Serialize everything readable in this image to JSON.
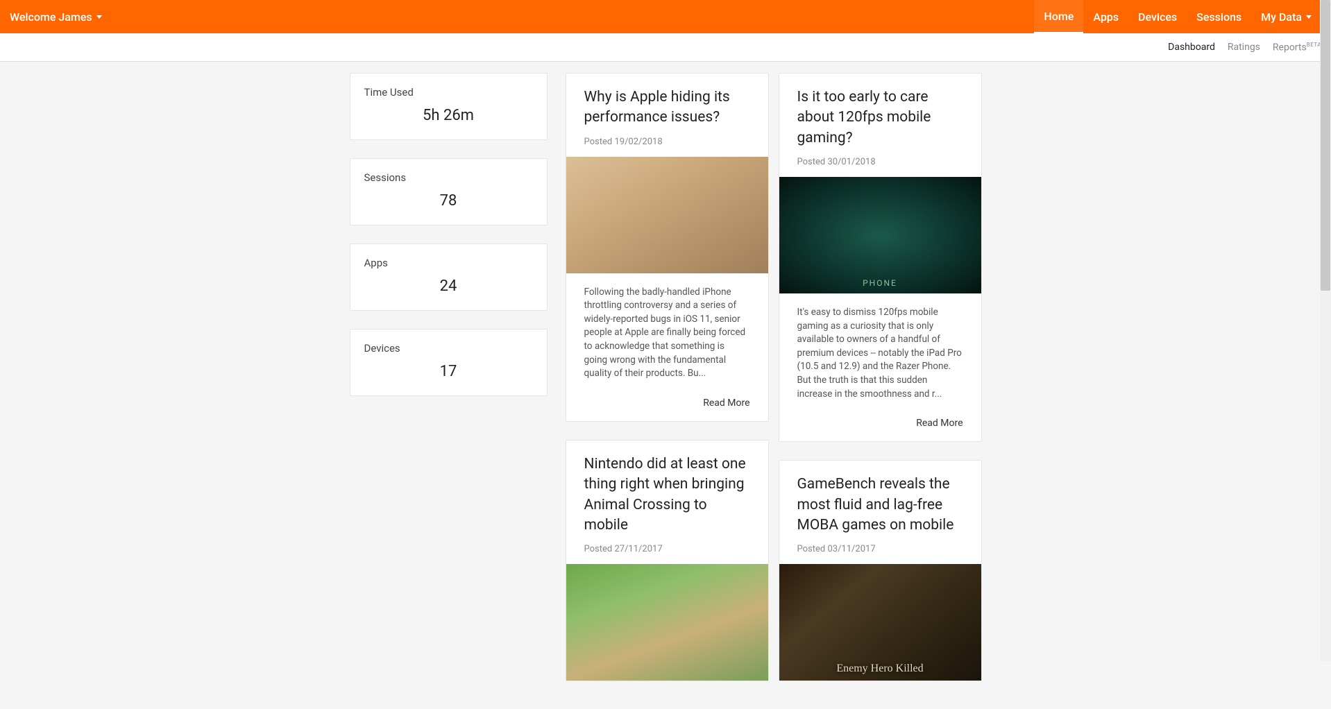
{
  "header": {
    "welcome": "Welcome James",
    "nav": [
      {
        "label": "Home",
        "active": true,
        "caret": false
      },
      {
        "label": "Apps",
        "active": false,
        "caret": false
      },
      {
        "label": "Devices",
        "active": false,
        "caret": false
      },
      {
        "label": "Sessions",
        "active": false,
        "caret": false
      },
      {
        "label": "My Data",
        "active": false,
        "caret": true
      }
    ]
  },
  "subnav": {
    "items": [
      {
        "label": "Dashboard",
        "active": true
      },
      {
        "label": "Ratings",
        "active": false
      },
      {
        "label": "Reports",
        "active": false,
        "beta": "BETA"
      }
    ]
  },
  "stats": [
    {
      "label": "Time Used",
      "value": "5h 26m"
    },
    {
      "label": "Sessions",
      "value": "78"
    },
    {
      "label": "Apps",
      "value": "24"
    },
    {
      "label": "Devices",
      "value": "17"
    }
  ],
  "articles": {
    "posted_prefix": "Posted ",
    "read_more": "Read More",
    "img_overlays": {
      "razer_phone": "PHONE",
      "enemy_killed": "Enemy Hero Killed"
    },
    "left": [
      {
        "title": "Why is Apple hiding its performance issues?",
        "date": "19/02/2018",
        "excerpt": "Following the badly-handled iPhone throttling controversy and a series of widely-reported bugs in iOS 11, senior people at Apple are finally being forced to acknowledge that something is going wrong with the fundamental quality of their products. Bu...",
        "imgclass": "img1"
      },
      {
        "title": "Nintendo did at least one thing right when bringing Animal Crossing to mobile",
        "date": "27/11/2017",
        "excerpt": "",
        "imgclass": "img3"
      }
    ],
    "right": [
      {
        "title": "Is it too early to care about 120fps mobile gaming?",
        "date": "30/01/2018",
        "excerpt": "It's easy to dismiss 120fps mobile gaming as a curiosity that is only available to owners of a handful of premium devices -- notably the iPad Pro (10.5 and 12.9) and the Razer Phone. But the truth is that this sudden increase in the smoothness and r...",
        "imgclass": "img2"
      },
      {
        "title": "GameBench reveals the most fluid and lag-free MOBA games on mobile",
        "date": "03/11/2017",
        "excerpt": "",
        "imgclass": "img4"
      }
    ]
  }
}
